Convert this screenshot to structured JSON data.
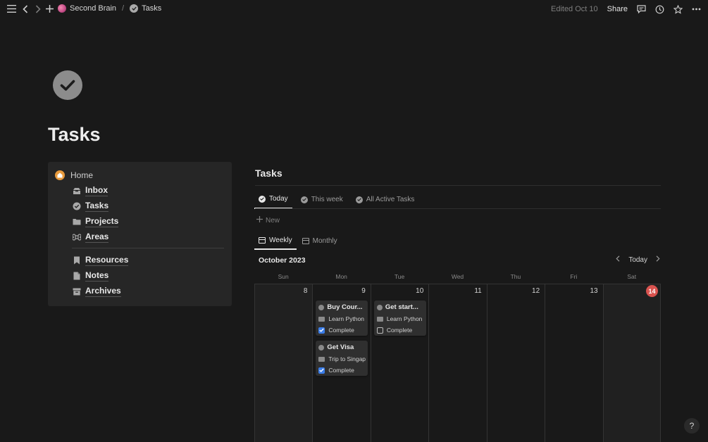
{
  "topbar": {
    "workspace": "Second Brain",
    "separator": "/",
    "page": "Tasks",
    "edited": "Edited Oct 10",
    "share": "Share"
  },
  "page": {
    "title": "Tasks"
  },
  "nav": {
    "home": "Home",
    "items": [
      "Inbox",
      "Tasks",
      "Projects",
      "Areas"
    ],
    "items2": [
      "Resources",
      "Notes",
      "Archives"
    ]
  },
  "db": {
    "title": "Tasks",
    "views": [
      "Today",
      "This week",
      "All Active Tasks"
    ],
    "new_label": "New",
    "cal_views": [
      "Weekly",
      "Monthly"
    ],
    "month": "October 2023",
    "today_label": "Today",
    "weekdays": [
      "Sun",
      "Mon",
      "Tue",
      "Wed",
      "Thu",
      "Fri",
      "Sat"
    ],
    "days": [
      "8",
      "9",
      "10",
      "11",
      "12",
      "13",
      "14"
    ]
  },
  "cards": [
    {
      "title": "Buy Cour...",
      "project": "Learn Python",
      "status": "Complete",
      "checked": true
    },
    {
      "title": "Get Visa",
      "project": "Trip to Singap",
      "status": "Complete",
      "checked": true
    },
    {
      "title": "Get start...",
      "project": "Learn Python",
      "status": "Complete",
      "checked": false
    }
  ],
  "colors": {
    "accent_today": "#d9534f",
    "checkbox_on": "#3b7de8",
    "home_badge": "#e89a3c"
  }
}
